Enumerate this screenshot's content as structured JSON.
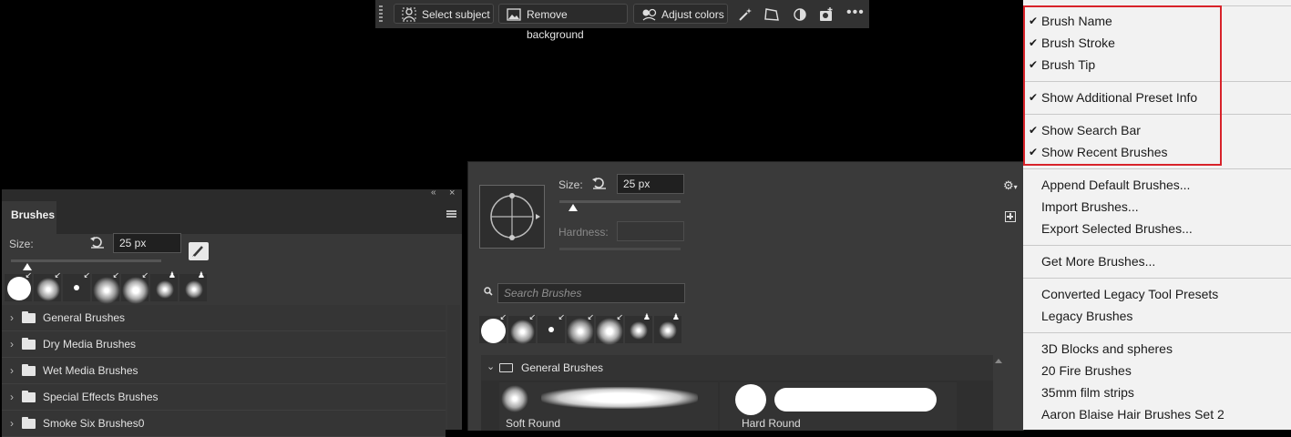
{
  "taskbar": {
    "buttons": [
      "Select subject",
      "Remove background",
      "Adjust colors"
    ],
    "icons": [
      "magic-wand-icon",
      "transform-icon",
      "contrast-icon",
      "mask-icon",
      "more-icon"
    ]
  },
  "brushes_panel": {
    "tab_label": "Brushes",
    "size_label": "Size:",
    "size_value": "25 px",
    "folders": [
      "General Brushes",
      "Dry Media Brushes",
      "Wet Media Brushes",
      "Special Effects Brushes",
      "Smoke Six Brushes0"
    ]
  },
  "preset_picker": {
    "size_label": "Size:",
    "size_value": "25 px",
    "hardness_label": "Hardness:",
    "search_placeholder": "Search Brushes",
    "group_label": "General Brushes",
    "brushes": [
      "Soft Round",
      "Hard Round"
    ]
  },
  "menu": {
    "checked_items": [
      "Brush Name",
      "Brush Stroke",
      "Brush Tip",
      "Show Additional Preset Info",
      "Show Search Bar",
      "Show Recent Brushes"
    ],
    "items": [
      "Append Default Brushes...",
      "Import Brushes...",
      "Export Selected Brushes...",
      "Get More Brushes...",
      "Converted Legacy Tool Presets",
      "Legacy Brushes",
      "3D Blocks and spheres",
      "20 Fire Brushes",
      "35mm film strips",
      "Aaron Blaise Hair Brushes Set 2"
    ]
  },
  "colors": {
    "highlight": "#d8232a",
    "panel": "#383838",
    "menu": "#f2f2f2"
  }
}
